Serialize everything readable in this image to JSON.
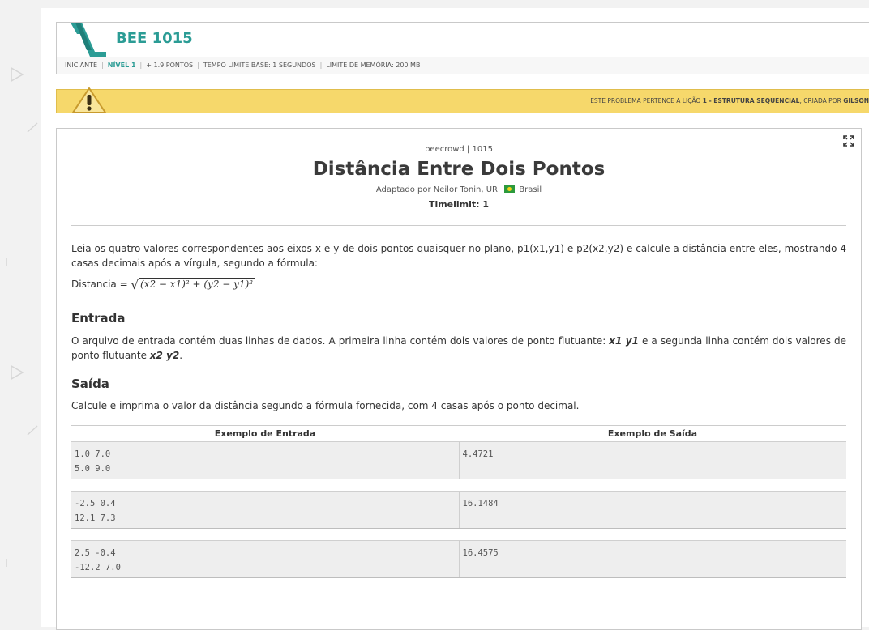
{
  "header": {
    "title": "BEE 1015",
    "meta": {
      "category": "INICIANTE",
      "level": "NÍVEL 1",
      "points": "+ 1.9 PONTOS",
      "time_limit": "TEMPO LIMITE BASE: 1 SEGUNDOS",
      "memory_limit": "LIMITE DE MEMÓRIA: 200 MB"
    }
  },
  "warning": {
    "prefix": "ESTE PROBLEMA PERTENCE A LIÇÃO ",
    "lesson": "1 - ESTRUTURA SEQUENCIAL",
    "suffix": ", CRIADA POR ",
    "author": "GILSON"
  },
  "problem": {
    "source": "beecrowd | 1015",
    "title": "Distância Entre Dois Pontos",
    "adapted_prefix": "Adaptado por Neilor Tonin, URI",
    "country": "Brasil",
    "timelimit": "Timelimit: 1",
    "description": "Leia os quatro valores correspondentes aos eixos x e y de dois pontos quaisquer no plano, p1(x1,y1) e p2(x2,y2) e calcule a distância entre eles, mostrando 4 casas decimais após a vírgula, segundo a fórmula:",
    "formula_label": "Distancia = ",
    "formula_radicand": "(x2 − x1)² + (y2 − y1)²",
    "input_heading": "Entrada",
    "input_text_1": "O arquivo de entrada contém duas linhas de dados. A primeira linha contém dois valores de ponto flutuante: ",
    "input_var_1": "x1 y1",
    "input_text_2": " e a segunda linha contém dois valores de ponto flutuante ",
    "input_var_2": "x2 y2",
    "input_text_3": ".",
    "output_heading": "Saída",
    "output_text": "Calcule e imprima o valor da distância segundo a fórmula fornecida, com 4 casas após o ponto decimal."
  },
  "examples": {
    "input_header": "Exemplo de Entrada",
    "output_header": "Exemplo de Saída",
    "rows": [
      {
        "input": "1.0 7.0\n5.0 9.0",
        "output": "4.4721"
      },
      {
        "input": "-2.5 0.4\n12.1 7.3",
        "output": "16.1484"
      },
      {
        "input": "2.5 -0.4\n-12.2 7.0",
        "output": "16.4575"
      }
    ]
  },
  "colors": {
    "accent": "#2b9c95",
    "warning_bg": "#f6d86b",
    "example_bg": "#eeeeee"
  }
}
